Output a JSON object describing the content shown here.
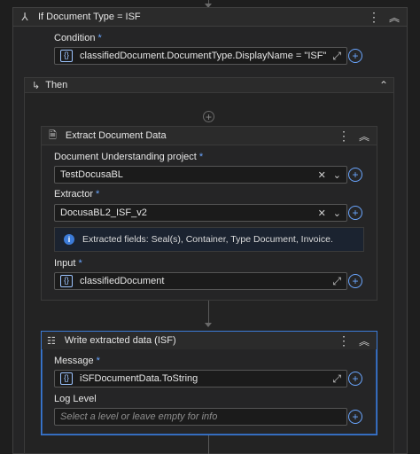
{
  "if_block": {
    "title": "If Document Type = ISF",
    "condition_label": "Condition",
    "required_mark": "*",
    "condition_value": "classifiedDocument.DocumentType.DisplayName = \"ISF\""
  },
  "then_block": {
    "title": "Then"
  },
  "extract_activity": {
    "title": "Extract Document Data",
    "project_label": "Document Understanding project",
    "project_value": "TestDocusaBL",
    "extractor_label": "Extractor",
    "extractor_value": "DocusaBL2_ISF_v2",
    "info_text": "Extracted fields: Seal(s), Container, Type Document, Invoice.",
    "input_label": "Input",
    "input_value": "classifiedDocument"
  },
  "write_activity": {
    "title": "Write extracted data (ISF)",
    "message_label": "Message",
    "message_value": "iSFDocumentData.ToString",
    "log_level_label": "Log Level",
    "log_level_placeholder": "Select a level or leave empty for info"
  },
  "icons": {
    "fx": "{}",
    "clear": "✕",
    "dropdown": "⌄",
    "expand": "⤢",
    "plus": "+",
    "kebab": "⋮",
    "collapse": "︽",
    "chevron_up": "⌃"
  },
  "colors": {
    "accent": "#3c7bd8",
    "info_bg": "#1b2330"
  }
}
